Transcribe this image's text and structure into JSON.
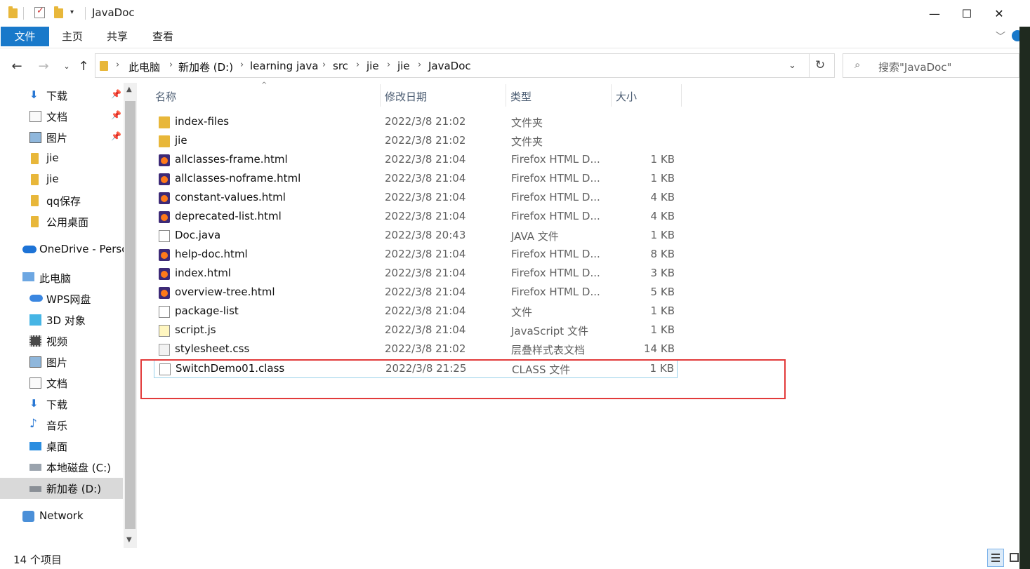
{
  "window": {
    "title": "JavaDoc",
    "controls": {
      "minimize": "—",
      "maximize": "☐",
      "close": "✕"
    }
  },
  "ribbon": {
    "tabs": [
      "文件",
      "主页",
      "共享",
      "查看"
    ]
  },
  "address": {
    "crumbs": [
      "此电脑",
      "新加卷 (D:)",
      "learning java",
      "src",
      "jie",
      "jie",
      "JavaDoc"
    ],
    "search_placeholder": "搜索\"JavaDoc\""
  },
  "sidebar": {
    "items": [
      {
        "label": "下载",
        "icon": "download-icon",
        "pinned": true
      },
      {
        "label": "文档",
        "icon": "document-icon",
        "pinned": true
      },
      {
        "label": "图片",
        "icon": "picture-icon",
        "pinned": true
      },
      {
        "label": "jie",
        "icon": "folder-icon",
        "pinned": false
      },
      {
        "label": "jie",
        "icon": "folder-icon",
        "pinned": false
      },
      {
        "label": "qq保存",
        "icon": "folder-icon",
        "pinned": false
      },
      {
        "label": "公用桌面",
        "icon": "folder-icon",
        "pinned": false
      },
      {
        "label": "OneDrive - Perso",
        "icon": "onedrive-icon",
        "pinned": false
      },
      {
        "label": "此电脑",
        "icon": "this-pc-icon",
        "pinned": false
      },
      {
        "label": "WPS网盘",
        "icon": "wps-cloud-icon",
        "pinned": false
      },
      {
        "label": "3D 对象",
        "icon": "3d-objects-icon",
        "pinned": false
      },
      {
        "label": "视频",
        "icon": "video-icon",
        "pinned": false
      },
      {
        "label": "图片",
        "icon": "picture-icon",
        "pinned": false
      },
      {
        "label": "文档",
        "icon": "document-icon",
        "pinned": false
      },
      {
        "label": "下载",
        "icon": "download-icon",
        "pinned": false
      },
      {
        "label": "音乐",
        "icon": "music-icon",
        "pinned": false
      },
      {
        "label": "桌面",
        "icon": "desktop-icon",
        "pinned": false
      },
      {
        "label": "本地磁盘 (C:)",
        "icon": "local-disk-icon",
        "pinned": false
      },
      {
        "label": "新加卷 (D:)",
        "icon": "drive-icon",
        "pinned": false
      },
      {
        "label": "Network",
        "icon": "network-icon",
        "pinned": false
      }
    ]
  },
  "columns": {
    "name": "名称",
    "date": "修改日期",
    "type": "类型",
    "size": "大小"
  },
  "files": [
    {
      "name": "index-files",
      "date": "2022/3/8 21:02",
      "type": "文件夹",
      "size": "",
      "icon": "folder"
    },
    {
      "name": "jie",
      "date": "2022/3/8 21:02",
      "type": "文件夹",
      "size": "",
      "icon": "folder"
    },
    {
      "name": "allclasses-frame.html",
      "date": "2022/3/8 21:04",
      "type": "Firefox HTML D...",
      "size": "1 KB",
      "icon": "ff"
    },
    {
      "name": "allclasses-noframe.html",
      "date": "2022/3/8 21:04",
      "type": "Firefox HTML D...",
      "size": "1 KB",
      "icon": "ff"
    },
    {
      "name": "constant-values.html",
      "date": "2022/3/8 21:04",
      "type": "Firefox HTML D...",
      "size": "4 KB",
      "icon": "ff"
    },
    {
      "name": "deprecated-list.html",
      "date": "2022/3/8 21:04",
      "type": "Firefox HTML D...",
      "size": "4 KB",
      "icon": "ff"
    },
    {
      "name": "Doc.java",
      "date": "2022/3/8 20:43",
      "type": "JAVA 文件",
      "size": "1 KB",
      "icon": "file"
    },
    {
      "name": "help-doc.html",
      "date": "2022/3/8 21:04",
      "type": "Firefox HTML D...",
      "size": "8 KB",
      "icon": "ff"
    },
    {
      "name": "index.html",
      "date": "2022/3/8 21:04",
      "type": "Firefox HTML D...",
      "size": "3 KB",
      "icon": "ff"
    },
    {
      "name": "overview-tree.html",
      "date": "2022/3/8 21:04",
      "type": "Firefox HTML D...",
      "size": "5 KB",
      "icon": "ff"
    },
    {
      "name": "package-list",
      "date": "2022/3/8 21:04",
      "type": "文件",
      "size": "1 KB",
      "icon": "file"
    },
    {
      "name": "script.js",
      "date": "2022/3/8 21:04",
      "type": "JavaScript 文件",
      "size": "1 KB",
      "icon": "js"
    },
    {
      "name": "stylesheet.css",
      "date": "2022/3/8 21:02",
      "type": "层叠样式表文档",
      "size": "14 KB",
      "icon": "css"
    },
    {
      "name": "SwitchDemo01.class",
      "date": "2022/3/8 21:25",
      "type": "CLASS 文件",
      "size": "1 KB",
      "icon": "file"
    }
  ],
  "status": {
    "item_count": "14 个项目"
  },
  "colors": {
    "accent": "#1979ca",
    "highlight_box": "#e23b3b",
    "selection_border": "#99d1ea"
  }
}
